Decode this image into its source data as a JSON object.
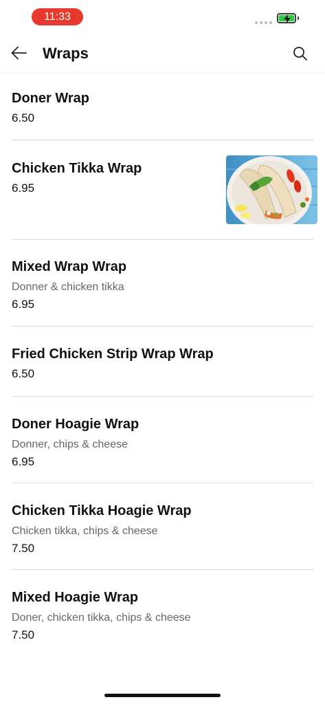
{
  "status_bar": {
    "time": "11:33",
    "time_pill_color": "#e8392f",
    "battery_color": "#2ecb43",
    "battery_icon": "battery-charging-icon"
  },
  "header": {
    "title": "Wraps",
    "back_icon": "arrow-left-icon",
    "search_icon": "search-icon"
  },
  "items": [
    {
      "name": "Doner Wrap",
      "price": "6.50"
    },
    {
      "name": "Chicken Tikka Wrap",
      "price": "6.95",
      "image": "wrap-photo"
    },
    {
      "name": "Mixed Wrap Wrap",
      "description": "Donner & chicken tikka",
      "price": "6.95"
    },
    {
      "name": "Fried Chicken Strip Wrap Wrap",
      "price": "6.50"
    },
    {
      "name": "Doner Hoagie Wrap",
      "description": "Donner, chips & cheese",
      "price": "6.95"
    },
    {
      "name": "Chicken Tikka Hoagie Wrap",
      "description": "Chicken tikka, chips & cheese",
      "price": "7.50"
    },
    {
      "name": "Mixed Hoagie Wrap",
      "description": "Doner, chicken tikka, chips & cheese",
      "price": "7.50"
    }
  ]
}
